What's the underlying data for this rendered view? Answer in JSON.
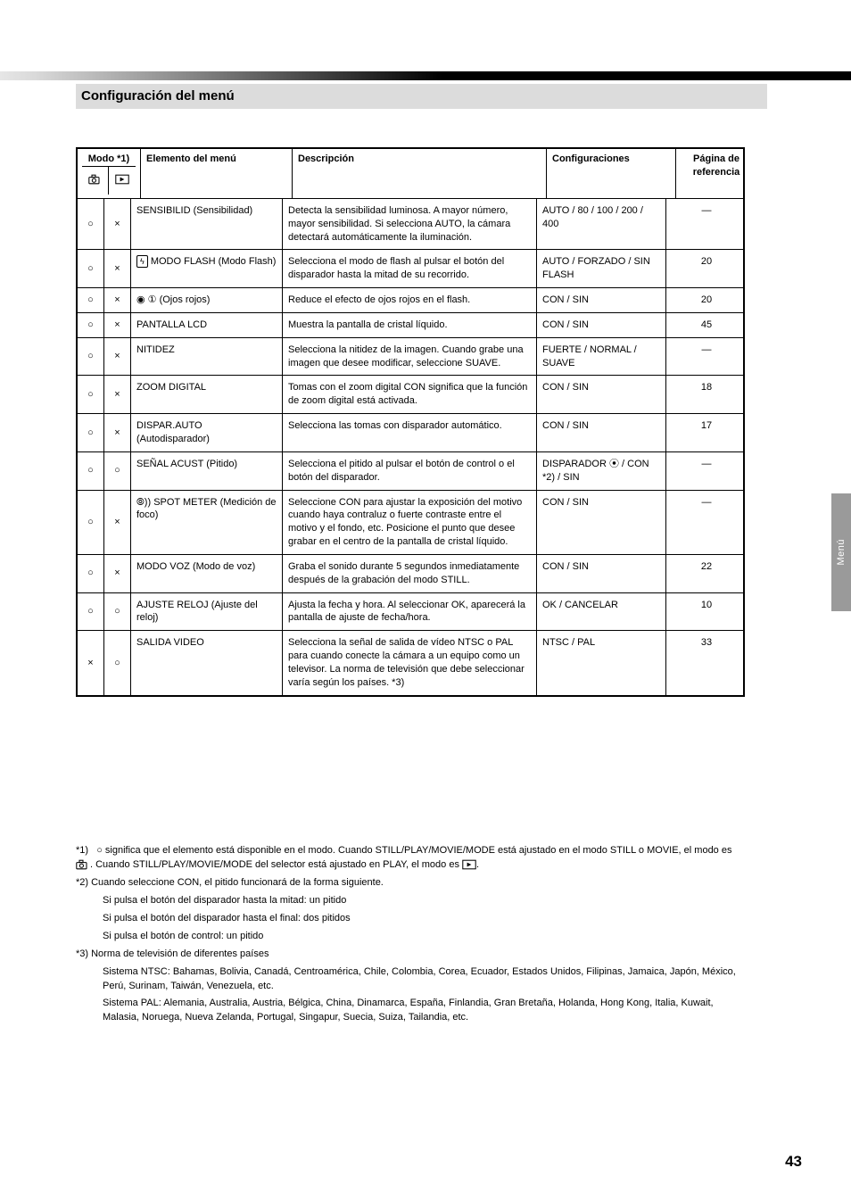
{
  "section_header": "Configuración del menú",
  "side_tab": "Menú",
  "page_number": "43",
  "table": {
    "head": {
      "mode": "Modo *1)",
      "menu": "Elemento del menú",
      "desc": "Descripción",
      "settings": "Configuraciones",
      "ref": "Página de referencia"
    },
    "rows": [
      {
        "mode_a": "○",
        "mode_b": "×",
        "menu": "SENSIBILID (Sensibilidad)",
        "desc": "Detecta la sensibilidad luminosa. A mayor número, mayor sensibilidad. Si selecciona AUTO, la cámara detectará automáticamente la iluminación.",
        "set": "AUTO / 80 / 100 / 200 / 400",
        "ref": "—"
      },
      {
        "mode_a": "○",
        "mode_b": "×",
        "menu": "MODO FLASH  (Modo Flash)",
        "desc": "Selecciona el modo de flash al pulsar el botón del disparador hasta la mitad de su recorrido.",
        "set": "AUTO / FORZADO / SIN FLASH",
        "ref": "20"
      },
      {
        "mode_a": "○",
        "mode_b": "×",
        "menu": "① (Ojos rojos)",
        "desc": "Reduce el efecto de ojos rojos en el flash.",
        "set": "CON / SIN",
        "ref": "20"
      },
      {
        "mode_a": "○",
        "mode_b": "×",
        "menu": "PANTALLA LCD",
        "desc": "Muestra la pantalla de cristal líquido.",
        "set": "CON / SIN",
        "ref": "45"
      },
      {
        "mode_a": "○",
        "mode_b": "×",
        "menu": "NITIDEZ",
        "desc": "Selecciona la nitidez de la imagen. Cuando grabe una imagen que desee modificar, seleccione SUAVE.",
        "set": "FUERTE / NORMAL / SUAVE",
        "ref": "—"
      },
      {
        "mode_a": "○",
        "mode_b": "×",
        "menu": "ZOOM DIGITAL",
        "desc": "Tomas con el zoom digital CON significa que la función de zoom digital está activada.",
        "set": "CON / SIN",
        "ref": "18"
      },
      {
        "mode_a": "○",
        "mode_b": "×",
        "menu": "DISPAR.AUTO (Autodisparador)",
        "desc": "Selecciona las tomas con disparador automático.",
        "set": "CON / SIN",
        "ref": "17"
      },
      {
        "mode_a": "○",
        "mode_b": "○",
        "menu": "SEÑAL ACUST (Pitido)",
        "desc": "Selecciona el pitido al pulsar el botón de control o el botón del disparador.",
        "set": "DISPARADOR / CON *2) / SIN",
        "ref": "—"
      },
      {
        "mode_a": "○",
        "mode_b": "×",
        "menu": "SPOT METER (Medición de foco)",
        "desc": "Seleccione CON para ajustar la exposición del motivo cuando haya contraluz o fuerte contraste entre el motivo y el fondo, etc. Posicione el punto que desee grabar en el centro de la pantalla de cristal líquido.",
        "set": "CON / SIN",
        "ref": "—"
      },
      {
        "mode_a": "○",
        "mode_b": "×",
        "menu": "MODO VOZ (Modo de voz)",
        "desc": "Graba el sonido durante 5 segundos inmediatamente después de la grabación del modo STILL.",
        "set": "CON / SIN",
        "ref": "22"
      },
      {
        "mode_a": "○",
        "mode_b": "○",
        "menu": "AJUSTE RELOJ (Ajuste del reloj)",
        "desc": "Ajusta la fecha y hora. Al seleccionar OK, aparecerá la pantalla de ajuste de fecha/hora.",
        "set": "OK / CANCELAR",
        "ref": "10"
      },
      {
        "mode_a": "×",
        "mode_b": "○",
        "menu": "SALIDA VIDEO",
        "desc": "Selecciona la señal de salida de vídeo NTSC o PAL para cuando conecte la cámara a un equipo como un televisor. La norma de televisión que debe seleccionar varía según los países. *3)",
        "set": "NTSC / PAL",
        "ref": "33"
      }
    ]
  },
  "notes": {
    "n1": "*1)   ○ significa que el elemento está disponible en el modo. Cuando STILL/PLAY/MOVIE/MODE está ajustado en el modo STILL o MOVIE, el modo es . Cuando STILL/PLAY/MOVIE/MODE del selector está ajustado en PLAY, el modo es .",
    "n2a": "*2)   Cuando seleccione CON, el pitido funcionará de la forma siguiente.",
    "n2b": "Si pulsa el botón del disparador hasta la mitad: un pitido",
    "n2c": "Si pulsa el botón del disparador hasta el final: dos pitidos",
    "n2d": "Si pulsa el botón de control: un pitido",
    "n3": "*3)   Norma de televisión de diferentes países",
    "n3a": "Sistema NTSC: Bahamas, Bolivia, Canadá, Centroamérica, Chile, Colombia, Corea, Ecuador, Estados Unidos, Filipinas, Jamaica, Japón, México, Perú, Surinam, Taiwán, Venezuela, etc.",
    "n3b": "Sistema PAL: Alemania, Australia, Austria, Bélgica, China, Dinamarca, España, Finlandia, Gran Bretaña, Holanda, Hong Kong, Italia, Kuwait, Malasia, Noruega, Nueva Zelanda, Portugal, Singapur, Suecia, Suiza, Tailandia, etc."
  }
}
